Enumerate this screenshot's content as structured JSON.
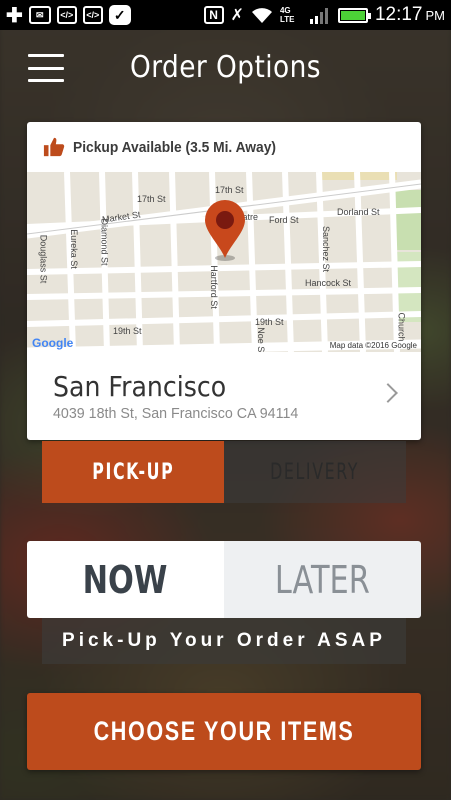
{
  "status_bar": {
    "time": "12:17",
    "ampm": "PM",
    "network": "4G LTE",
    "icons": [
      "add-icon",
      "mail-icon",
      "code-icon",
      "code-icon",
      "check-icon",
      "nfc-icon",
      "mute-icon",
      "wifi-icon",
      "signal-icon",
      "battery-icon"
    ]
  },
  "header": {
    "title": "Order Options",
    "menu_icon": "hamburger-menu-icon"
  },
  "location_card": {
    "pickup_status": "Pickup Available (3.5 Mi. Away)",
    "status_icon": "thumbs-up-icon",
    "map": {
      "streets": [
        "17th St",
        "17th St",
        "Market St",
        "Theatre",
        "Ford St",
        "Dorland St",
        "Douglass St",
        "Eureka St",
        "Diamond St",
        "Hartford St",
        "Sanchez St",
        "Hancock St",
        "19th St",
        "19th St",
        "Noe St",
        "Church"
      ],
      "attribution_logo": "Google",
      "attribution": "Map data ©2016 Google",
      "marker_icon": "map-pin-icon"
    },
    "city": "San Francisco",
    "address": "4039 18th St, San Francisco CA 94114",
    "chevron_icon": "chevron-right-icon"
  },
  "fulfillment": {
    "options": [
      "PICK-UP",
      "DELIVERY"
    ],
    "selected": "PICK-UP"
  },
  "timing": {
    "options": [
      "NOW",
      "LATER"
    ],
    "selected": "NOW",
    "note": "Pick-Up Your Order ASAP"
  },
  "cta": {
    "label": "CHOOSE YOUR ITEMS"
  },
  "colors": {
    "accent": "#bd4b1c",
    "text_dark": "#3a424a",
    "battery": "#4cd137"
  }
}
